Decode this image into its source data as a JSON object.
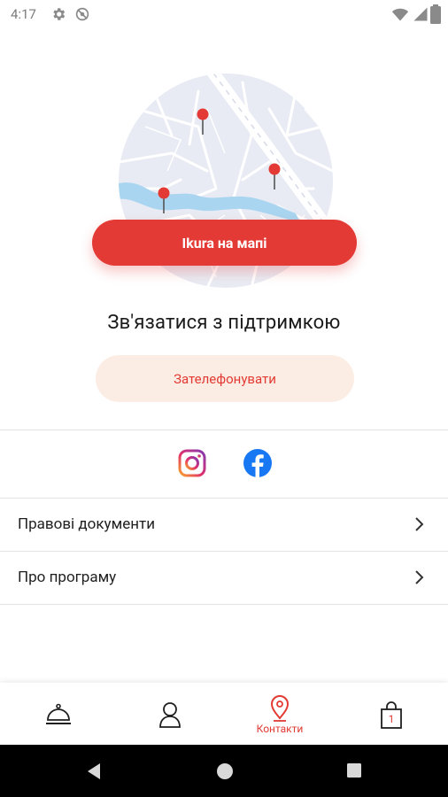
{
  "status_bar": {
    "time": "4:17"
  },
  "map": {
    "button_label": "Ikura на мапі",
    "pin_color": "#e33a35",
    "water_color": "#a9d5f0"
  },
  "support": {
    "title": "Зв'язатися з підтримкою",
    "call_label": "Зателефонувати"
  },
  "social": [
    {
      "icon": "instagram-icon"
    },
    {
      "icon": "facebook-icon"
    }
  ],
  "menu": {
    "items": [
      {
        "label": "Правові документи"
      },
      {
        "label": "Про програму"
      }
    ]
  },
  "bottom_nav": {
    "items": [
      {
        "icon": "cloche-icon",
        "label": ""
      },
      {
        "icon": "profile-icon",
        "label": ""
      },
      {
        "icon": "location-pin-icon",
        "label": "Контакти",
        "active": true
      },
      {
        "icon": "shopping-bag-icon",
        "label": "",
        "badge": "1"
      }
    ],
    "accent": "#e23b34"
  },
  "colors": {
    "accent": "#e33a35",
    "call_bg": "#fcede4"
  }
}
